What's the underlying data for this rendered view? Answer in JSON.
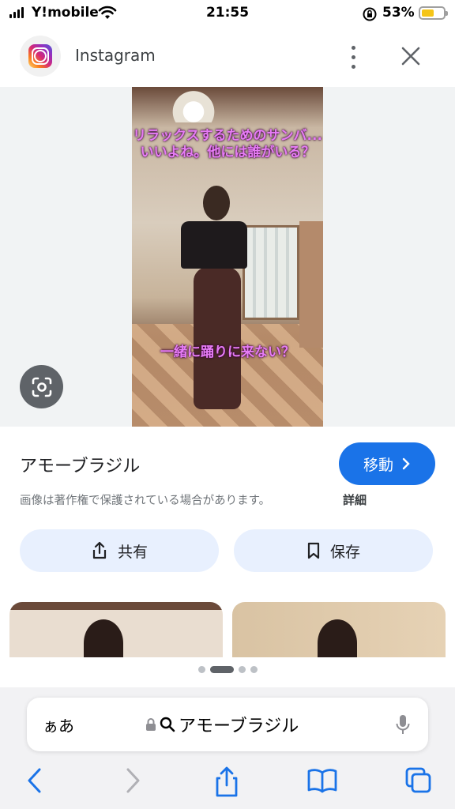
{
  "status_bar": {
    "carrier": "Y!mobile",
    "time": "21:55",
    "battery": "53%"
  },
  "header": {
    "site_name": "Instagram",
    "icons": [
      "instagram-logo-icon",
      "more-vert-icon",
      "close-icon"
    ]
  },
  "image": {
    "caption_top": "リラックスするためのサンバ...いいよね。他には誰がいる？",
    "caption_bottom": "一緒に踊りに来ない？"
  },
  "result": {
    "title": "アモーブラジル",
    "visit_label": "移動",
    "copyright_notice": "画像は著作権で保護されている場合があります。",
    "details_label": "詳細",
    "share_label": "共有",
    "save_label": "保存"
  },
  "carousel": {
    "page_count": 4,
    "active_index": 1
  },
  "browser": {
    "aa_label": "ぁあ",
    "url_text": "アモーブラジル"
  },
  "colors": {
    "accent": "#1a73e8",
    "chip_bg": "#e8f0fe",
    "caption": "#e67cf5",
    "battery": "#f5c518"
  }
}
